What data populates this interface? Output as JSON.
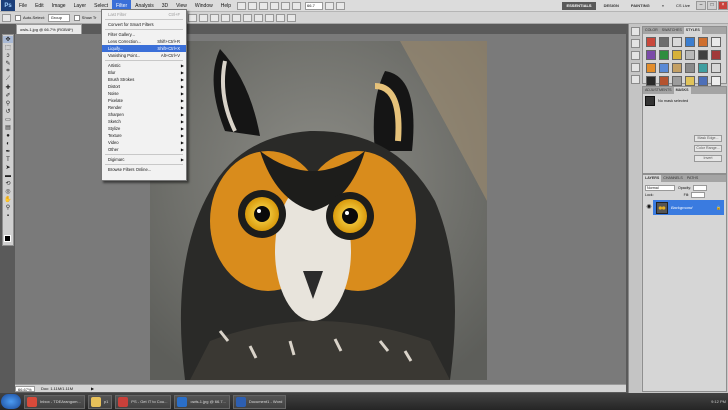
{
  "menubar": {
    "logo": "Ps",
    "items": [
      "File",
      "Edit",
      "Image",
      "Layer",
      "Select",
      "Filter",
      "Analysis",
      "3D",
      "View",
      "Window",
      "Help"
    ],
    "active_item": "Filter",
    "zoom": "66.7",
    "workspaces": [
      "ESSENTIALS",
      "DESIGN",
      "PAINTING"
    ],
    "active_workspace": "ESSENTIALS",
    "cs_live": "CS Live"
  },
  "options_bar": {
    "auto_select_label": "Auto-Select:",
    "auto_select_value": "Group",
    "show_transform_label": "Show Tr"
  },
  "document": {
    "tab_title": "owls-1.jpg @ 66.7% (RGB/8*)"
  },
  "filter_menu": {
    "items": [
      {
        "label": "Last Filter",
        "shortcut": "Ctrl+F",
        "disabled": true
      },
      {
        "sep": true
      },
      {
        "label": "Convert for Smart Filters"
      },
      {
        "sep": true
      },
      {
        "label": "Filter Gallery..."
      },
      {
        "label": "Lens Correction...",
        "shortcut": "Shift+Ctrl+R"
      },
      {
        "label": "Liquify...",
        "shortcut": "Shift+Ctrl+X",
        "highlighted": true
      },
      {
        "label": "Vanishing Point...",
        "shortcut": "Alt+Ctrl+V"
      },
      {
        "sep": true
      },
      {
        "label": "Artistic",
        "submenu": true
      },
      {
        "label": "Blur",
        "submenu": true
      },
      {
        "label": "Brush Strokes",
        "submenu": true
      },
      {
        "label": "Distort",
        "submenu": true
      },
      {
        "label": "Noise",
        "submenu": true
      },
      {
        "label": "Pixelate",
        "submenu": true
      },
      {
        "label": "Render",
        "submenu": true
      },
      {
        "label": "Sharpen",
        "submenu": true
      },
      {
        "label": "Sketch",
        "submenu": true
      },
      {
        "label": "Stylize",
        "submenu": true
      },
      {
        "label": "Texture",
        "submenu": true
      },
      {
        "label": "Video",
        "submenu": true
      },
      {
        "label": "Other",
        "submenu": true
      },
      {
        "sep": true
      },
      {
        "label": "Digimarc",
        "submenu": true
      },
      {
        "sep": true
      },
      {
        "label": "Browse Filters Online..."
      }
    ]
  },
  "status_bar": {
    "zoom": "66.67%",
    "doc_size": "Doc: 1.11M/1.11M"
  },
  "panels": {
    "styles_tabs": [
      "COLOR",
      "SWATCHES",
      "STYLES"
    ],
    "styles_active": "STYLES",
    "style_colors": [
      "#c9483b",
      "#6c6c6c",
      "#d9d9d9",
      "#3c7ecf",
      "#cf6f2e",
      "#e9e9e9",
      "#7b4aa8",
      "#2f8d3e",
      "#d6b13a",
      "#b9b9b9",
      "#404040",
      "#a13a3a",
      "#e38e2c",
      "#5a8ad6",
      "#c4a064",
      "#8a8a8a",
      "#3f9fa1",
      "#d6d6d6",
      "#2a2a2a",
      "#b5532f",
      "#9c9c9c",
      "#e0c35a",
      "#4d6fb8",
      "#ededed"
    ],
    "mask_tabs": [
      "ADJUSTMENTS",
      "MASKS"
    ],
    "mask_active": "MASKS",
    "mask_title": "No mask selected",
    "mask_buttons": [
      "Mask Edge...",
      "Color Range...",
      "Invert"
    ],
    "layers_tabs": [
      "LAYERS",
      "CHANNELS",
      "PATHS"
    ],
    "layers_active": "LAYERS",
    "blend_mode": "Normal",
    "opacity_label": "Opacity:",
    "lock_label": "Lock:",
    "fill_label": "Fill:",
    "layer_name": "Background"
  },
  "taskbar": {
    "tasks": [
      {
        "label": "Inbox - TDEArangom...",
        "color": "#d84a3a"
      },
      {
        "label": "p1",
        "color": "#e8c15a"
      },
      {
        "label": "PS - Get IT to Cou...",
        "color": "#c8403a"
      },
      {
        "label": "owls-1.jpg @ 66.7...",
        "color": "#2a6fc9"
      },
      {
        "label": "Document1 - Word",
        "color": "#2d5fb2"
      }
    ],
    "tray_time": "9:12 PM"
  },
  "colors": {
    "accent": "#3a6fd8",
    "layer_selected": "#3a7be0"
  }
}
